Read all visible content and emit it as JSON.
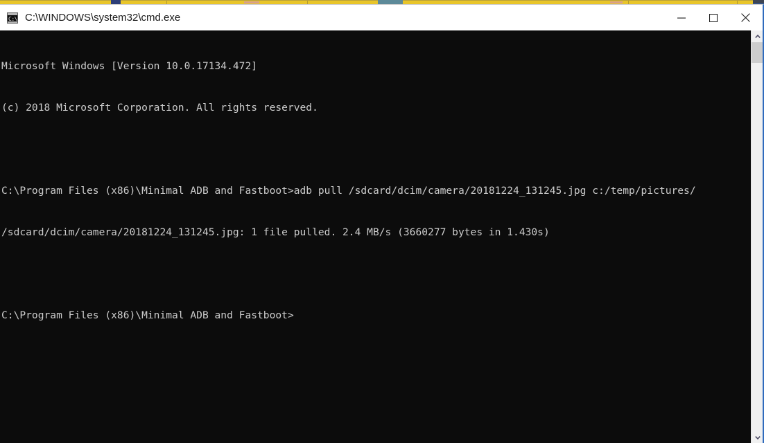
{
  "background": {
    "strip_color": "#e8c52a",
    "description": "partially-visible browser tab bar behind the console window"
  },
  "window": {
    "title": "C:\\WINDOWS\\system32\\cmd.exe",
    "icon_name": "cmd-exe-icon",
    "icon_glyph": "C:\\",
    "background_color": "#0c0c0c",
    "text_color": "#cccccc",
    "border_color": "#2f6bbd",
    "controls": {
      "minimize_label": "Minimize",
      "maximize_label": "Maximize",
      "close_label": "Close"
    }
  },
  "console": {
    "lines": [
      "Microsoft Windows [Version 10.0.17134.472]",
      "(c) 2018 Microsoft Corporation. All rights reserved.",
      "",
      "C:\\Program Files (x86)\\Minimal ADB and Fastboot>adb pull /sdcard/dcim/camera/20181224_131245.jpg c:/temp/pictures/",
      "/sdcard/dcim/camera/20181224_131245.jpg: 1 file pulled. 2.4 MB/s (3660277 bytes in 1.430s)",
      "",
      "C:\\Program Files (x86)\\Minimal ADB and Fastboot>"
    ],
    "os_name": "Microsoft Windows",
    "os_version": "10.0.17134.472",
    "copyright": "(c) 2018 Microsoft Corporation. All rights reserved.",
    "prompt": "C:\\Program Files (x86)\\Minimal ADB and Fastboot>",
    "command": "adb pull /sdcard/dcim/camera/20181224_131245.jpg c:/temp/pictures/",
    "result": {
      "source_file": "/sdcard/dcim/camera/20181224_131245.jpg",
      "status": "1 file pulled.",
      "speed": "2.4 MB/s",
      "bytes": "3660277 bytes",
      "elapsed": "1.430s"
    }
  },
  "scrollbar": {
    "up_arrow_name": "scroll-up-arrow",
    "down_arrow_name": "scroll-down-arrow",
    "thumb_name": "scrollbar-thumb"
  }
}
